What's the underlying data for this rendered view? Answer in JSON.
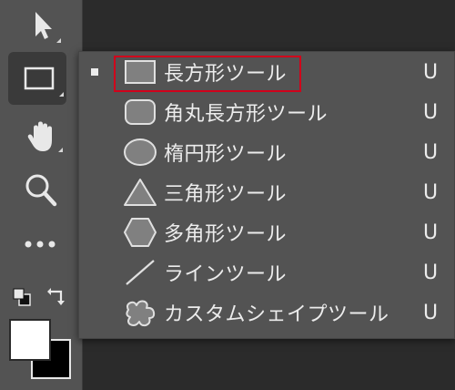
{
  "toolbar": {
    "tools": [
      {
        "name": "move-tool",
        "icon": "arrow-cursor-icon"
      },
      {
        "name": "rectangle-tool",
        "icon": "rectangle-icon",
        "active": true
      },
      {
        "name": "hand-tool",
        "icon": "hand-icon"
      },
      {
        "name": "zoom-tool",
        "icon": "magnifier-icon"
      },
      {
        "name": "more-tools",
        "icon": "ellipsis-icon"
      }
    ]
  },
  "menu": {
    "items": [
      {
        "label": "長方形ツール",
        "shortcut": "U",
        "icon": "rectangle-shape-icon",
        "selected": true
      },
      {
        "label": "角丸長方形ツール",
        "shortcut": "U",
        "icon": "rounded-rectangle-icon"
      },
      {
        "label": "楕円形ツール",
        "shortcut": "U",
        "icon": "ellipse-icon"
      },
      {
        "label": "三角形ツール",
        "shortcut": "U",
        "icon": "triangle-icon"
      },
      {
        "label": "多角形ツール",
        "shortcut": "U",
        "icon": "polygon-icon"
      },
      {
        "label": "ラインツール",
        "shortcut": "U",
        "icon": "line-icon"
      },
      {
        "label": "カスタムシェイプツール",
        "shortcut": "U",
        "icon": "custom-shape-icon"
      }
    ]
  },
  "colors": {
    "foreground": "#ffffff",
    "background": "#000000",
    "highlight": "#d0021b"
  }
}
